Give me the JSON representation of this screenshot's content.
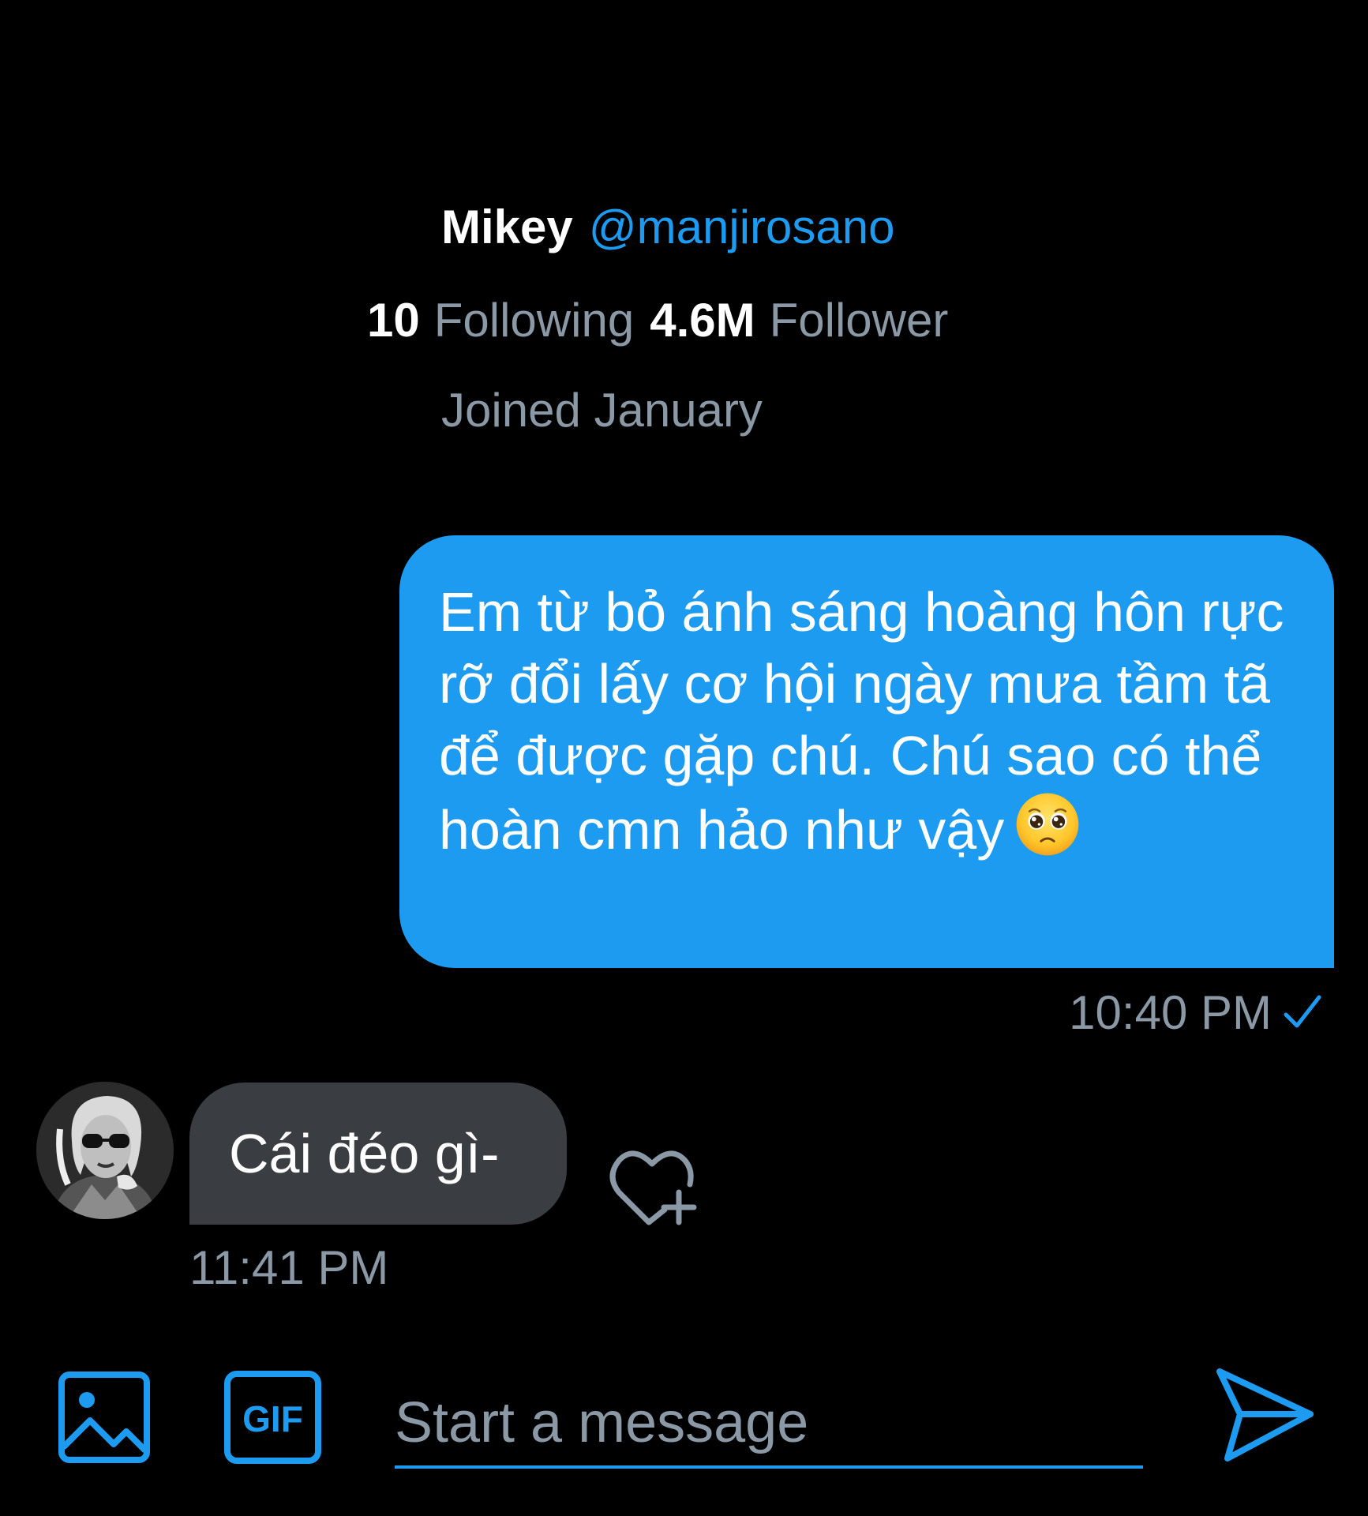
{
  "profile": {
    "name": "Mikey",
    "handle": "@manjirosano",
    "following_count": "10",
    "following_label": "Following",
    "followers_count": "4.6M",
    "followers_label": "Follower",
    "joined": "Joined January"
  },
  "conversation": {
    "sent_message": {
      "text": "Em từ bỏ ánh sáng hoàng hôn rực rỡ đổi lấy cơ hội ngày mưa tầm tã để được gặp chú. Chú sao có thể hoàn cmn hảo như vậy",
      "emoji": "pleading-face-emoji",
      "time": "10:40 PM",
      "status_icon": "check-icon"
    },
    "received_message": {
      "text": "Cái đéo gì-",
      "time": "11:41 PM",
      "reaction_icon": "add-reaction-heart-icon"
    }
  },
  "composer": {
    "placeholder": "Start a message",
    "value": "",
    "media_icon": "image-icon",
    "gif_label": "GIF",
    "send_icon": "send-icon"
  },
  "colors": {
    "background": "#000000",
    "accent": "#1d9bf0",
    "secondary_text": "#8b98a5",
    "received_bubble": "#3a3d41"
  }
}
